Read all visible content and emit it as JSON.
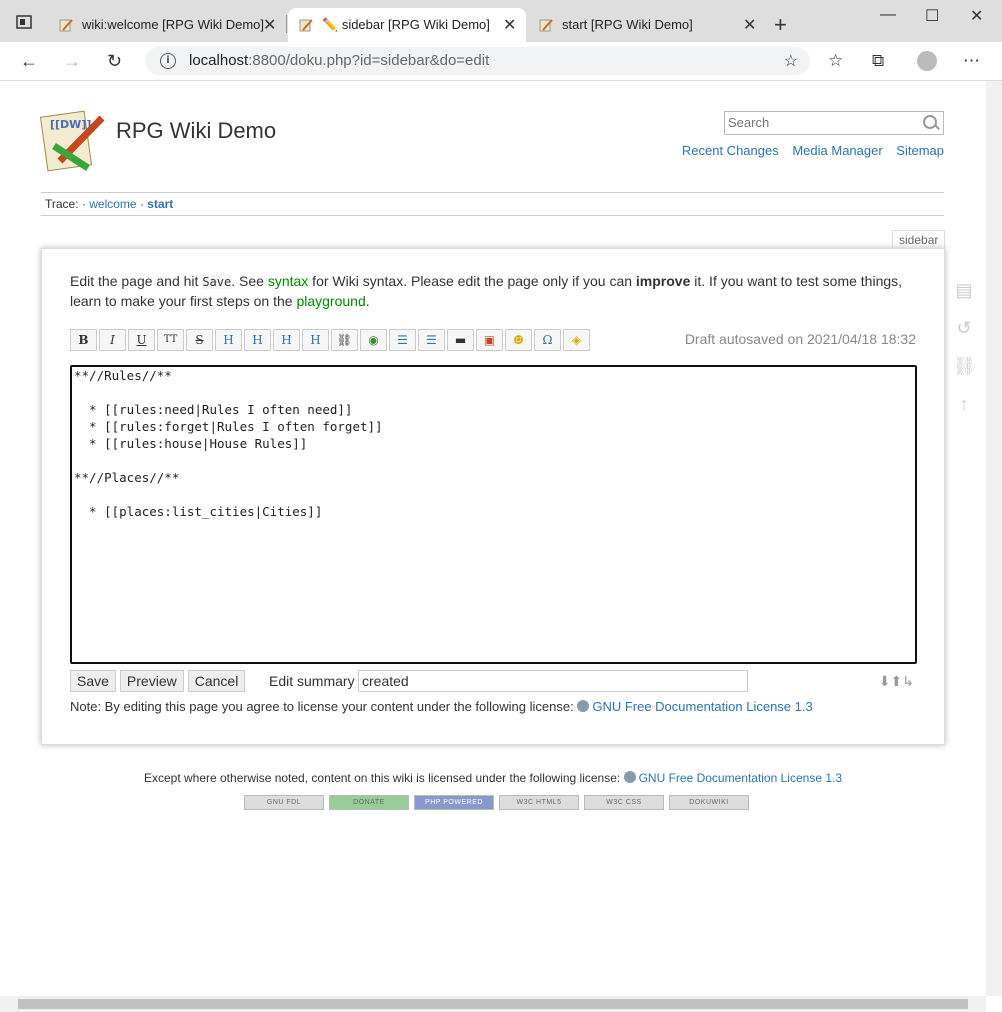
{
  "browser": {
    "tabs": [
      {
        "title": "wiki:welcome [RPG Wiki Demo]"
      },
      {
        "title": "sidebar [RPG Wiki Demo]"
      },
      {
        "title": "start [RPG Wiki Demo]"
      }
    ],
    "url_host": "localhost",
    "url_rest": ":8800/doku.php?id=sidebar&do=edit"
  },
  "site": {
    "title": "RPG Wiki Demo",
    "search_placeholder": "Search",
    "links": [
      "Recent Changes",
      "Media Manager",
      "Sitemap"
    ]
  },
  "trace": {
    "label": "Trace:",
    "items": [
      "welcome",
      "start"
    ]
  },
  "page_name": "sidebar",
  "intro": {
    "p1": "Edit the page and hit ",
    "code": "Save",
    "p2": ". See ",
    "syntax_link": "syntax",
    "p3": " for Wiki syntax. Please edit the page only if you can ",
    "improve": "improve",
    "p4": " it. If you want to test some things, learn to make your first steps on the ",
    "playground_link": "playground",
    "p5": "."
  },
  "toolbar": [
    "B",
    "I",
    "U",
    "TT",
    "S",
    "H",
    "H",
    "H",
    "H",
    "link",
    "ext",
    "ol",
    "ul",
    "hr",
    "img",
    "smile",
    "Ω",
    "plugin"
  ],
  "draft_status": "Draft autosaved on 2021/04/18 18:32",
  "editor_text": "**//Rules//**\n\n  * [[rules:need|Rules I often need]]\n  * [[rules:forget|Rules I often forget]]\n  * [[rules:house|House Rules]]\n\n**//Places//**\n\n  * [[places:list_cities|Cities]]",
  "buttons": {
    "save": "Save",
    "preview": "Preview",
    "cancel": "Cancel"
  },
  "summary": {
    "label": "Edit summary",
    "value": "created"
  },
  "license_note": {
    "text": "Note: By editing this page you agree to license your content under the following license:",
    "link": "GNU Free Documentation License 1.3"
  },
  "footer": {
    "text": "Except where otherwise noted, content on this wiki is licensed under the following license:",
    "link": "GNU Free Documentation License 1.3"
  },
  "badges": [
    "GNU FDL",
    "DONATE",
    "PHP POWERED",
    "W3C HTML5",
    "W3C CSS",
    "DOKUWIKI"
  ]
}
